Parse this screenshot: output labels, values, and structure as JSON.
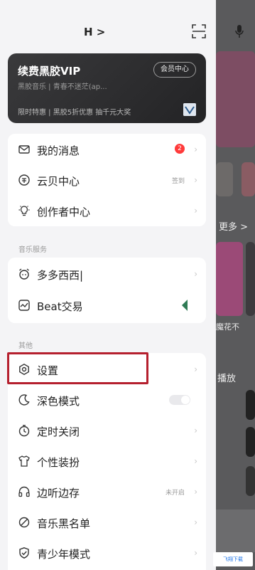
{
  "header": {
    "user_name": "H >"
  },
  "vip": {
    "title": "续费黑胶VIP",
    "subtitle": "黑胶音乐 | 青春不迷茫(ap...",
    "button": "会员中心",
    "promo": "限时特惠 | 黑胶5折优惠 抽千元大奖"
  },
  "menu_main": [
    {
      "label": "我的消息",
      "badge": "2",
      "icon": "mail-icon"
    },
    {
      "label": "云贝中心",
      "right_text": "签到",
      "icon": "coin-icon"
    },
    {
      "label": "创作者中心",
      "icon": "bulb-icon"
    }
  ],
  "section_music": {
    "title": "音乐服务"
  },
  "menu_music": [
    {
      "label": "多多西西|",
      "icon": "alarm-icon"
    },
    {
      "label": "Beat交易",
      "icon": "chart-icon"
    }
  ],
  "section_other": {
    "title": "其他"
  },
  "menu_other": [
    {
      "label": "设置",
      "icon": "gear-icon"
    },
    {
      "label": "深色模式",
      "icon": "moon-icon",
      "toggle": "off"
    },
    {
      "label": "定时关闭",
      "icon": "timer-icon"
    },
    {
      "label": "个性装扮",
      "icon": "shirt-icon"
    },
    {
      "label": "边听边存",
      "right_text": "未开启",
      "icon": "headphone-icon"
    },
    {
      "label": "音乐黑名单",
      "icon": "block-icon"
    },
    {
      "label": "青少年模式",
      "icon": "shield-icon"
    }
  ],
  "background": {
    "text_more": "更多 >",
    "text_cover": "魔花不",
    "text_play": "播放"
  },
  "watermark": "飞翔下载"
}
